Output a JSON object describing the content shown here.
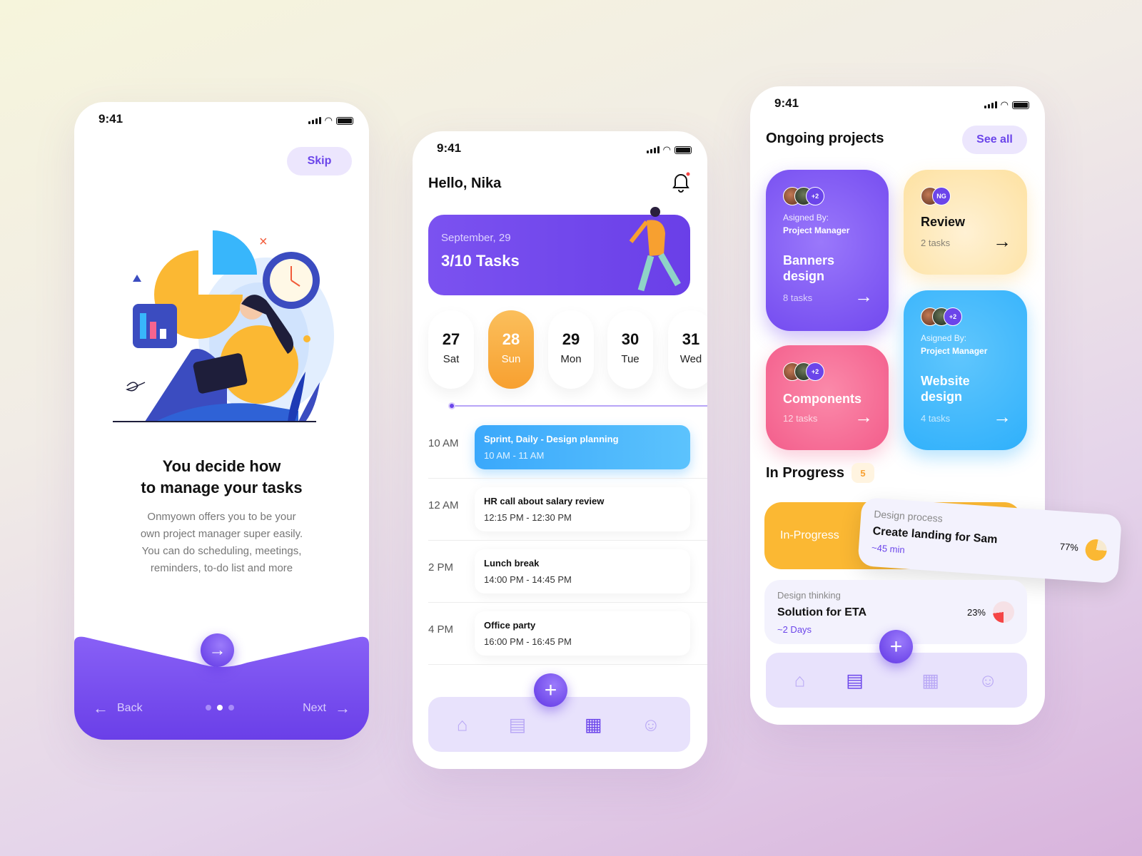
{
  "status": {
    "time": "9:41"
  },
  "onboarding": {
    "skip": "Skip",
    "title_line1": "You decide how",
    "title_line2": "to manage your tasks",
    "body": [
      "Onmyown offers you to be your",
      "own project manager super easily.",
      "You can do scheduling, meetings,",
      "reminders, to-do list and more"
    ],
    "back": "Back",
    "next": "Next",
    "page_dots": 3,
    "active_dot": 2
  },
  "home": {
    "greeting": "Hello, Nika",
    "banner": {
      "date": "September, 29",
      "tasks": "3/10 Tasks"
    },
    "days": [
      {
        "num": "27",
        "name": "Sat"
      },
      {
        "num": "28",
        "name": "Sun",
        "active": true
      },
      {
        "num": "29",
        "name": "Mon"
      },
      {
        "num": "30",
        "name": "Tue"
      },
      {
        "num": "31",
        "name": "Wed"
      }
    ],
    "schedule": [
      {
        "time": "10 AM",
        "title": "Sprint, Daily - Design planning",
        "range": "10 AM - 11 AM",
        "highlight": true
      },
      {
        "time": "12 AM",
        "title": "HR call about salary review",
        "range": "12:15 PM - 12:30 PM"
      },
      {
        "time": "2 PM",
        "title": "Lunch break",
        "range": "14:00 PM - 14:45 PM"
      },
      {
        "time": "4 PM",
        "title": "Office party",
        "range": "16:00 PM - 16:45 PM"
      }
    ],
    "nav": [
      "home-icon",
      "clipboard-icon",
      "calendar-icon",
      "user-icon"
    ],
    "nav_active": 2
  },
  "projects": {
    "title": "Ongoing projects",
    "see_all": "See all",
    "cards": [
      {
        "assigned_label": "Asigned By:",
        "assigned_by": "Project Manager",
        "name_line1": "Banners",
        "name_line2": "design",
        "tasks": "8 tasks",
        "more": "+2",
        "color": "#7b52f0"
      },
      {
        "name": "Review",
        "tasks": "2 tasks",
        "initials": "NG",
        "color": "#fde3a6"
      },
      {
        "name": "Components",
        "tasks": "12 tasks",
        "more": "+2",
        "color": "#f6648f"
      },
      {
        "assigned_label": "Asigned By:",
        "assigned_by": "Project Manager",
        "name_line1": "Website",
        "name_line2": "design",
        "tasks": "4 tasks",
        "more": "+2",
        "color": "#34b4fb"
      }
    ],
    "in_progress": {
      "title": "In Progress",
      "count": "5",
      "tag": "In-Progress",
      "items": [
        {
          "category": "Design process",
          "title": "Create landing for Sam",
          "eta": "~45 min",
          "percent": 77,
          "percent_label": "77%",
          "color": "#fbb833"
        },
        {
          "category": "Design thinking",
          "title": "Solution for ETA",
          "eta": "~2 Days",
          "percent": 23,
          "percent_label": "23%",
          "color": "#f54545"
        }
      ]
    },
    "nav": [
      "home-icon",
      "clipboard-icon",
      "calendar-icon",
      "user-icon"
    ],
    "nav_active": 1
  },
  "colors": {
    "accent": "#6b45ea",
    "orange": "#f7a030",
    "blue": "#34b4fb",
    "pink": "#f6648f"
  }
}
